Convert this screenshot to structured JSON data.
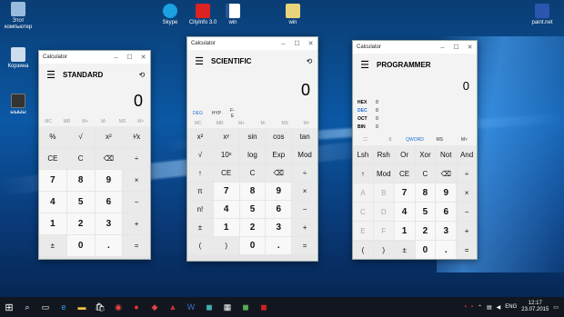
{
  "desktop": {
    "icons": [
      {
        "label": "Этот компьютер",
        "color": "#9bd"
      },
      {
        "label": "Корзина",
        "color": "#cde"
      },
      {
        "label": "ыыыы",
        "color": "#333"
      },
      {
        "label": "Skype",
        "color": "#1ba0e0"
      },
      {
        "label": "CityInfo 3.0",
        "color": "#d22"
      },
      {
        "label": "win",
        "color": "#2b5797"
      },
      {
        "label": "win",
        "color": "#e8d47a"
      },
      {
        "label": "paint.net",
        "color": "#2a56b0"
      }
    ]
  },
  "standard": {
    "title": "Calculator",
    "mode": "STANDARD",
    "display": "0",
    "mem": [
      "MC",
      "MR",
      "M+",
      "M-",
      "MS",
      "M˅"
    ],
    "keys": [
      "%",
      "√",
      "x²",
      "¹⁄x",
      "CE",
      "C",
      "⌫",
      "÷",
      "7",
      "8",
      "9",
      "×",
      "4",
      "5",
      "6",
      "−",
      "1",
      "2",
      "3",
      "+",
      "±",
      "0",
      ".",
      "="
    ]
  },
  "scientific": {
    "title": "Calculator",
    "mode": "SCIENTIFIC",
    "display": "0",
    "angle": [
      "DEG",
      "HYP",
      "F-E"
    ],
    "mem": [
      "MC",
      "MR",
      "M+",
      "M-",
      "MS",
      "M˅"
    ],
    "keys": [
      "x²",
      "xʸ",
      "sin",
      "cos",
      "tan",
      "√",
      "10ˣ",
      "log",
      "Exp",
      "Mod",
      "↑",
      "CE",
      "C",
      "⌫",
      "÷",
      "π",
      "7",
      "8",
      "9",
      "×",
      "n!",
      "4",
      "5",
      "6",
      "−",
      "±",
      "1",
      "2",
      "3",
      "+",
      "(",
      ")",
      "0",
      ".",
      "="
    ]
  },
  "programmer": {
    "title": "Calculator",
    "mode": "PROGRAMMER",
    "display": "0",
    "bases": [
      {
        "name": "HEX",
        "val": "0"
      },
      {
        "name": "DEC",
        "val": "0"
      },
      {
        "name": "OCT",
        "val": "0"
      },
      {
        "name": "BIN",
        "val": "0"
      }
    ],
    "tools": [
      "⁚⁚⁚",
      "⁞⁞",
      "QWORD",
      "MS",
      "M˅"
    ],
    "keys": [
      "Lsh",
      "Rsh",
      "Or",
      "Xor",
      "Not",
      "And",
      "↑",
      "Mod",
      "CE",
      "C",
      "⌫",
      "÷",
      "A",
      "B",
      "7",
      "8",
      "9",
      "×",
      "C",
      "D",
      "4",
      "5",
      "6",
      "−",
      "E",
      "F",
      "1",
      "2",
      "3",
      "+",
      "(",
      ")",
      "±",
      "0",
      ".",
      "="
    ]
  },
  "taskbar": {
    "lang": "ENG",
    "time": "12:17",
    "date": "23.07.2015"
  }
}
